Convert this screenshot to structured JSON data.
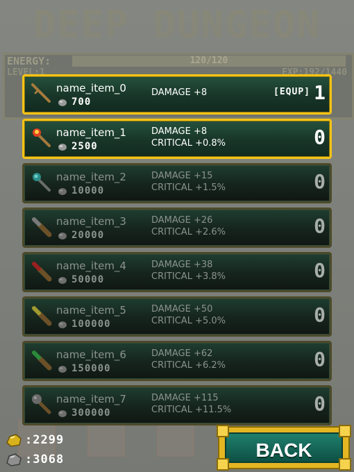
{
  "background": {
    "title": "DEEP DUNGEON",
    "energy_label": "ENERGY:",
    "energy_value": "120/120",
    "level": "LEVEL:1",
    "exp": "EXP:192/1440"
  },
  "items": [
    {
      "name": "name_item_0",
      "price": "700",
      "damage": "DAMAGE +8",
      "critical": "",
      "equip": "[EQUP]",
      "count": "1",
      "state": "enabled",
      "icon": "stick-icon"
    },
    {
      "name": "name_item_1",
      "price": "2500",
      "damage": "DAMAGE +8",
      "critical": "CRITICAL +0.8%",
      "equip": "",
      "count": "0",
      "state": "enabled",
      "icon": "torch-icon"
    },
    {
      "name": "name_item_2",
      "price": "10000",
      "damage": "DAMAGE +15",
      "critical": "CRITICAL +1.5%",
      "equip": "",
      "count": "0",
      "state": "locked",
      "icon": "wand-icon"
    },
    {
      "name": "name_item_3",
      "price": "20000",
      "damage": "DAMAGE +26",
      "critical": "CRITICAL +2.6%",
      "equip": "",
      "count": "0",
      "state": "locked",
      "icon": "club-icon"
    },
    {
      "name": "name_item_4",
      "price": "50000",
      "damage": "DAMAGE +38",
      "critical": "CRITICAL +3.8%",
      "equip": "",
      "count": "0",
      "state": "locked",
      "icon": "club-icon"
    },
    {
      "name": "name_item_5",
      "price": "100000",
      "damage": "DAMAGE +50",
      "critical": "CRITICAL +5.0%",
      "equip": "",
      "count": "0",
      "state": "locked",
      "icon": "club-icon"
    },
    {
      "name": "name_item_6",
      "price": "150000",
      "damage": "DAMAGE +62",
      "critical": "CRITICAL +6.2%",
      "equip": "",
      "count": "0",
      "state": "locked",
      "icon": "club-icon"
    },
    {
      "name": "name_item_7",
      "price": "300000",
      "damage": "DAMAGE +115",
      "critical": "CRITICAL +11.5%",
      "equip": "",
      "count": "0",
      "state": "locked",
      "icon": "mace-icon"
    }
  ],
  "currency": {
    "gold": ":2299",
    "stone": ":3068"
  },
  "back_label": "BACK",
  "colors": {
    "accent_gold": "#f3c416",
    "row_green": "#1f3d30",
    "button_teal": "#1f7f6d"
  }
}
